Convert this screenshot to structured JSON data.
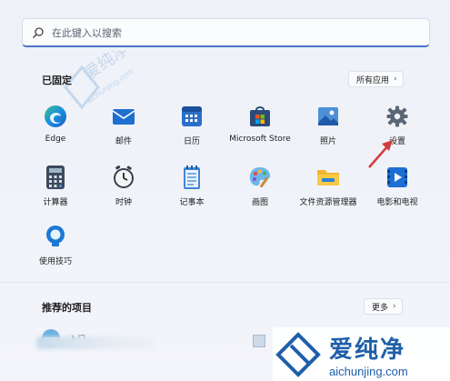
{
  "search": {
    "placeholder": "在此键入以搜索"
  },
  "pinned": {
    "title": "已固定",
    "all_apps_label": "所有应用",
    "apps_row1": [
      "Edge",
      "邮件",
      "日历",
      "Microsoft Store",
      "照片",
      "设置"
    ],
    "apps_row2": [
      "计算器",
      "时钟",
      "记事本",
      "画图",
      "文件资源管理器",
      "电影和电视"
    ],
    "apps_row3": [
      "使用技巧"
    ]
  },
  "recommended": {
    "title": "推荐的项目",
    "more_label": "更多",
    "item1": "入门"
  },
  "watermark": {
    "cn": "爱纯净",
    "en": "aichunjing.com",
    "ghost_cn": "爱纯净",
    "ghost_en": "aichunjing.com"
  },
  "colors": {
    "accent": "#4a73c8",
    "arrow": "#d23c3c",
    "brand": "#1f5faa"
  }
}
